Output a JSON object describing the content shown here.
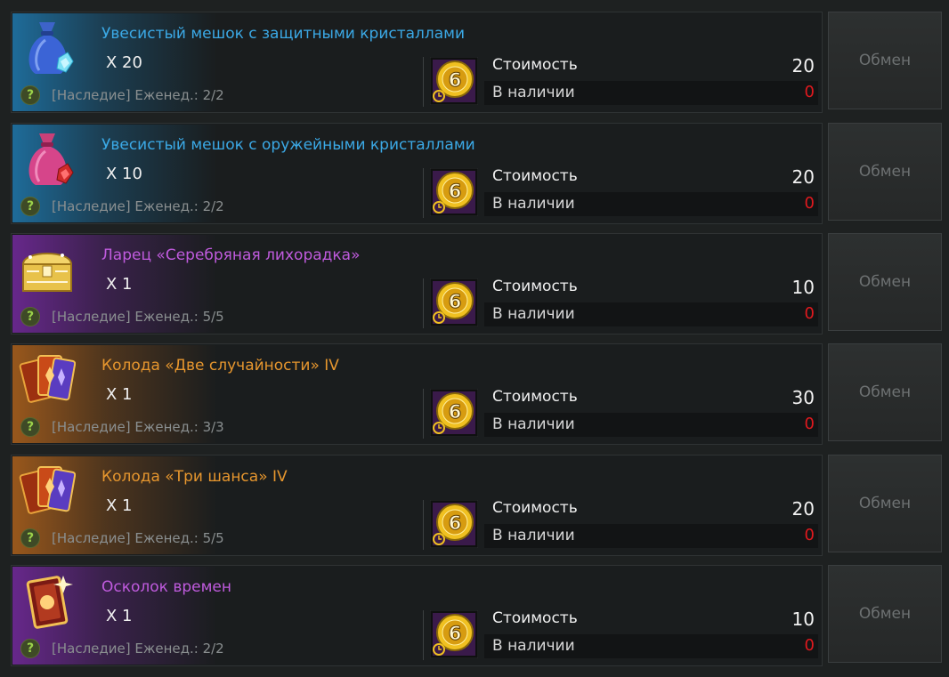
{
  "labels": {
    "cost": "Стоимость",
    "stock": "В наличии",
    "exchange": "Обмен",
    "help": "?"
  },
  "currency_icon": "gold-coin-6-icon",
  "items": [
    {
      "name": "Увесистый мешок с защитными кристаллами",
      "name_color": "#3ba9e6",
      "glow_color": "#1f7fb8",
      "icon": "blue-crystal-bag-icon",
      "quantity": "X 20",
      "limit": "[Наследие] Еженед.: 2/2",
      "cost": "20",
      "stock": "0"
    },
    {
      "name": "Увесистый мешок с оружейными кристаллами",
      "name_color": "#3ba9e6",
      "glow_color": "#1f7fb8",
      "icon": "pink-crystal-bag-icon",
      "quantity": "X 10",
      "limit": "[Наследие] Еженед.: 2/2",
      "cost": "20",
      "stock": "0"
    },
    {
      "name": "Ларец «Серебряная лихорадка»",
      "name_color": "#c05bde",
      "glow_color": "#7a2aa6",
      "icon": "golden-chest-icon",
      "quantity": "X 1",
      "limit": "[Наследие] Еженед.: 5/5",
      "cost": "10",
      "stock": "0"
    },
    {
      "name": "Колода «Две случайности» IV",
      "name_color": "#e6962e",
      "glow_color": "#b8661c",
      "icon": "card-deck-icon",
      "quantity": "X 1",
      "limit": "[Наследие] Еженед.: 3/3",
      "cost": "30",
      "stock": "0"
    },
    {
      "name": "Колода «Три шанса» IV",
      "name_color": "#e6962e",
      "glow_color": "#b8661c",
      "icon": "card-deck-icon",
      "quantity": "X 1",
      "limit": "[Наследие] Еженед.: 5/5",
      "cost": "20",
      "stock": "0"
    },
    {
      "name": "Осколок времен",
      "name_color": "#c05bde",
      "glow_color": "#7a2aa6",
      "icon": "time-shard-card-icon",
      "quantity": "X 1",
      "limit": "[Наследие] Еженед.: 2/2",
      "cost": "10",
      "stock": "0"
    }
  ]
}
